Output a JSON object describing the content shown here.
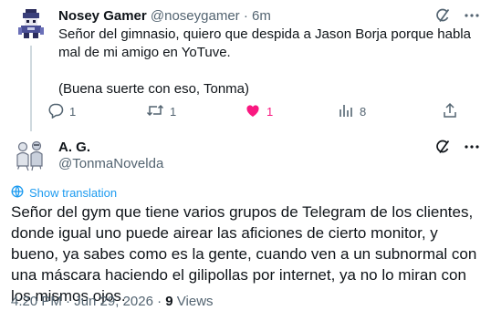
{
  "reply": {
    "name": "Nosey Gamer",
    "handle": "@noseygamer",
    "separator": "·",
    "time": "6m",
    "text_line1": "Señor del gimnasio, quiero que despida a Jason Borja porque habla mal de mi amigo en YoTuve.",
    "text_line2": "(Buena suerte con eso, Tonma)",
    "actions": {
      "reply_count": "1",
      "repost_count": "1",
      "like_count": "1",
      "views_count": "8"
    },
    "icons": {
      "grok": "grok-icon",
      "more": "more-icon",
      "reply": "reply-icon",
      "repost": "repost-icon",
      "like": "heart-filled-icon",
      "views": "views-icon",
      "share": "share-icon"
    },
    "like_color": "#f91880"
  },
  "main": {
    "name": "A. G.",
    "handle": "@TonmaNovelda",
    "translate_label": "Show translation",
    "text": "Señor del gym que tiene varios grupos de Telegram de los clientes, donde igual uno puede airear las aficiones de cierto monitor, y bueno, ya sabes como es la gente, cuando ven a un subnormal con una máscara haciendo el gilipollas por internet, ya no lo miran con los mismos ojos.",
    "timestamp": "4:20 PM · Jun 29, 2026",
    "separator": "·",
    "views_count": "9",
    "views_label": "Views",
    "accent_color": "#1d9bf0"
  }
}
